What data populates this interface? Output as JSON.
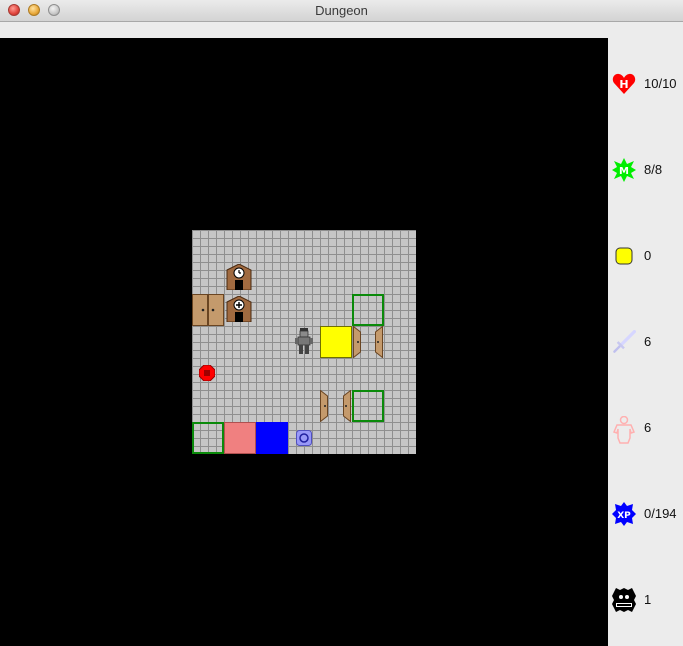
{
  "window": {
    "title": "Dungeon"
  },
  "stats": {
    "health": {
      "icon": "health-heart-icon",
      "value": "10/10",
      "color": "#ff0000"
    },
    "mana": {
      "icon": "mana-star-icon",
      "value": "8/8",
      "color": "#00ee00"
    },
    "gold": {
      "icon": "gold-coin-icon",
      "value": "0",
      "color": "#ffff00"
    },
    "attack": {
      "icon": "sword-icon",
      "value": "6",
      "color": "#c8c8ff"
    },
    "defense": {
      "icon": "body-armor-icon",
      "value": "6",
      "color": "#ffc0c0"
    },
    "experience": {
      "icon": "xp-badge-icon",
      "value": "0/194",
      "color": "#0000ff"
    },
    "level": {
      "icon": "level-badge-icon",
      "value": "1",
      "color": "#000000"
    }
  },
  "map": {
    "floor_color": "#c6c6c6",
    "entities": [
      {
        "name": "shop-clock-building",
        "icon": "clock-building-icon"
      },
      {
        "name": "shop-plus-building",
        "icon": "plus-building-icon"
      },
      {
        "name": "wooden-double-door",
        "icon": "double-door-icon"
      },
      {
        "name": "player-character",
        "icon": "player-icon"
      },
      {
        "name": "yellow-block",
        "icon": "yellow-block-icon",
        "color": "#ffff00"
      },
      {
        "name": "red-gem",
        "icon": "red-gem-icon",
        "color": "#ff0000"
      },
      {
        "name": "pink-block",
        "icon": "pink-block-icon",
        "color": "#f08080"
      },
      {
        "name": "blue-block",
        "icon": "blue-block-icon",
        "color": "#0000ff"
      },
      {
        "name": "blue-orb",
        "icon": "blue-orb-icon",
        "color": "#9090ff"
      }
    ]
  }
}
